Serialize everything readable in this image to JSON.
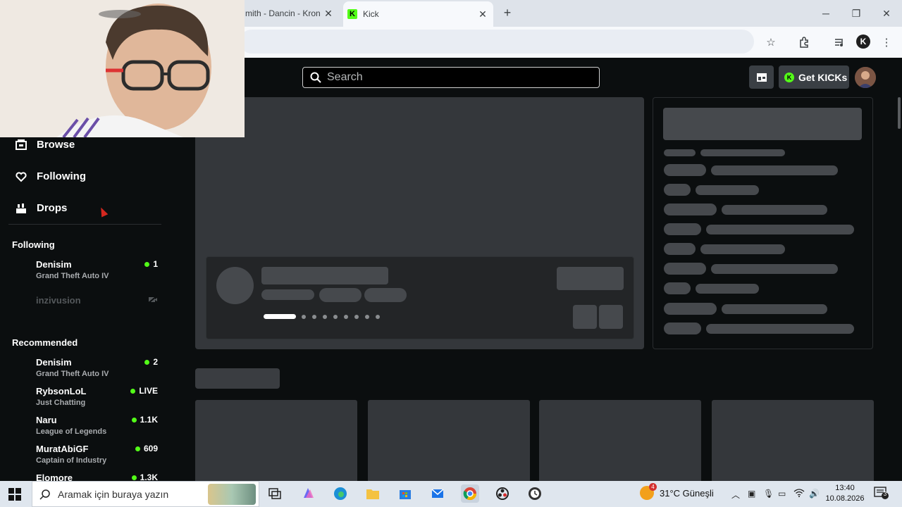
{
  "browser": {
    "tabs": [
      {
        "title": "mith - Dancin - Kron",
        "active": false
      },
      {
        "title": "Kick",
        "active": true
      }
    ],
    "profile_initial": "K"
  },
  "header": {
    "search_placeholder": "Search",
    "get_kicks_label": "Get KICKs"
  },
  "sidebar": {
    "nav": [
      {
        "label": "Browse",
        "icon": "browse-icon"
      },
      {
        "label": "Following",
        "icon": "heart-icon"
      },
      {
        "label": "Drops",
        "icon": "drops-icon"
      }
    ],
    "following_title": "Following",
    "following": [
      {
        "name": "Denisim",
        "category": "Grand Theft Auto IV",
        "viewers": "1",
        "live": true
      },
      {
        "name": "inzivusion",
        "category": "",
        "viewers": "",
        "live": false
      }
    ],
    "recommended_title": "Recommended",
    "recommended": [
      {
        "name": "Denisim",
        "category": "Grand Theft Auto IV",
        "viewers": "2"
      },
      {
        "name": "RybsonLoL",
        "category": "Just Chatting",
        "viewers": "LIVE"
      },
      {
        "name": "Naru",
        "category": "League of Legends",
        "viewers": "1.1K"
      },
      {
        "name": "MuratAbiGF",
        "category": "Captain of Industry",
        "viewers": "609"
      },
      {
        "name": "Elomore",
        "category": "",
        "viewers": "1.3K"
      }
    ]
  },
  "taskbar": {
    "search_placeholder": "Aramak için buraya yazın",
    "weather": "31°C Güneşli",
    "weather_badge": "4",
    "time": "13:40",
    "date": "10.08.2026",
    "notification_count": "3"
  },
  "colors": {
    "kick_green": "#53fc18",
    "background": "#0b0e0f",
    "skeleton": "#34373b"
  }
}
